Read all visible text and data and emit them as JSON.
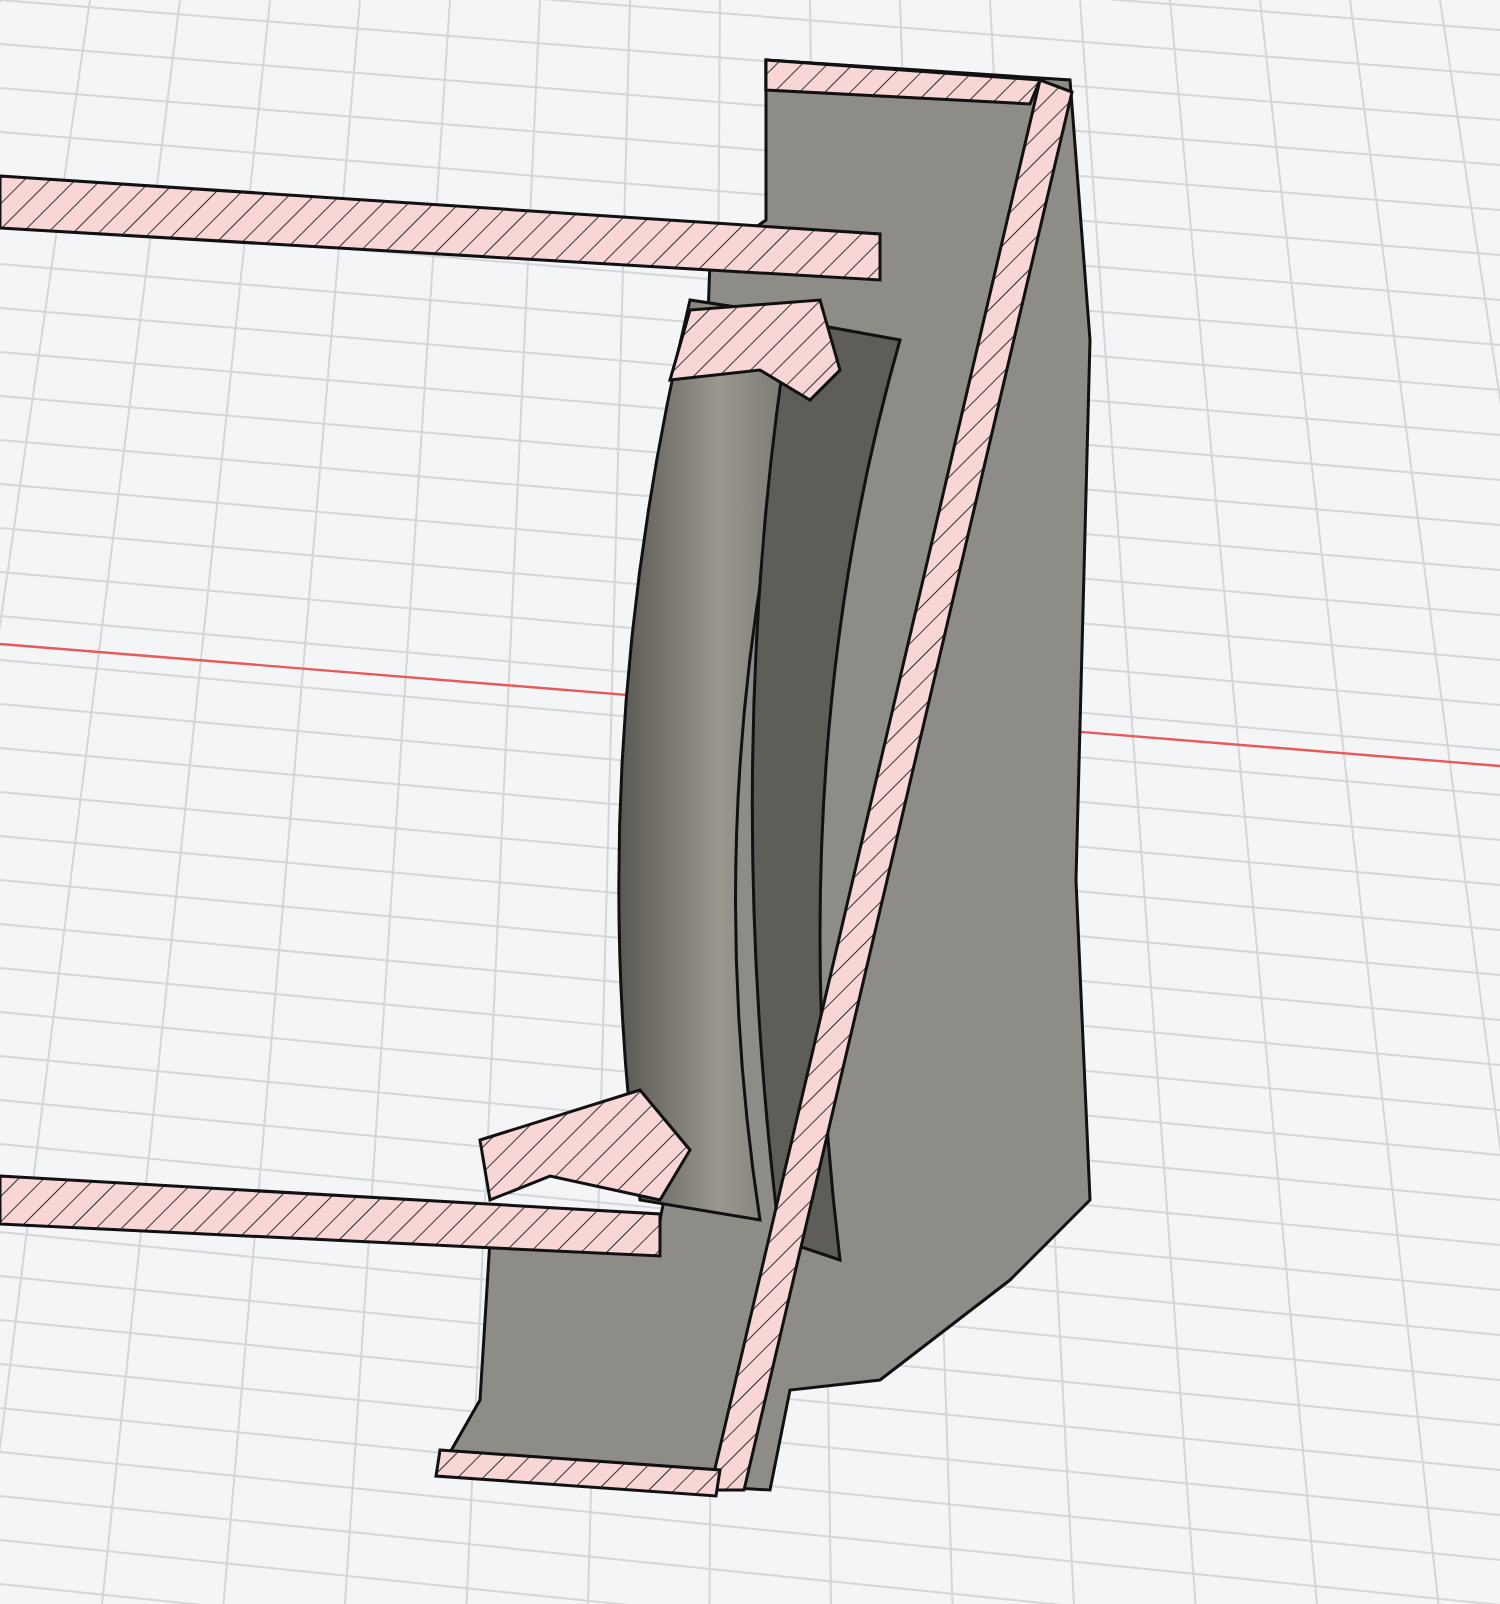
{
  "viewport": {
    "grid": true,
    "axis_line": true
  }
}
